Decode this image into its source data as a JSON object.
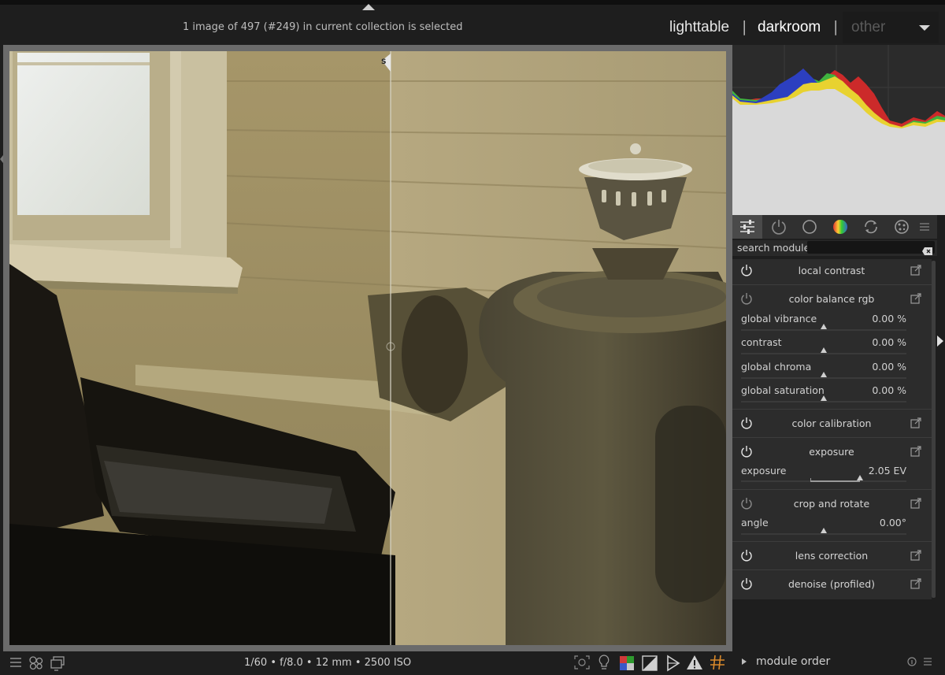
{
  "header": {
    "collection_info": "1 image of 497 (#249) in current collection is selected",
    "views": {
      "lighttable": "lighttable",
      "darkroom": "darkroom",
      "other": "other",
      "separator": "|"
    }
  },
  "module_groups": {
    "tabs": [
      "quick-access-icon",
      "active-modules-icon",
      "base-group-icon",
      "color-group-icon",
      "correct-group-icon",
      "effect-group-icon",
      "presets-menu-icon"
    ],
    "active_index": 0
  },
  "search": {
    "label": "search module",
    "placeholder": ""
  },
  "modules": [
    {
      "title": "local contrast",
      "enabled": true
    },
    {
      "title": "color balance rgb",
      "enabled": false,
      "sliders": [
        {
          "label": "global vibrance",
          "value": "0.00 %",
          "fraction": 0.5
        },
        {
          "label": "contrast",
          "value": "0.00 %",
          "fraction": 0.5
        },
        {
          "label": "global chroma",
          "value": "0.00 %",
          "fraction": 0.5
        },
        {
          "label": "global saturation",
          "value": "0.00 %",
          "fraction": 0.5
        }
      ]
    },
    {
      "title": "color calibration",
      "enabled": true
    },
    {
      "title": "exposure",
      "enabled": true,
      "sliders": [
        {
          "label": "exposure",
          "value": "2.05 EV",
          "fraction": 0.72
        }
      ]
    },
    {
      "title": "crop and rotate",
      "enabled": false,
      "sliders": [
        {
          "label": "angle",
          "value": "0.00°",
          "fraction": 0.5
        }
      ]
    },
    {
      "title": "lens correction",
      "enabled": true
    },
    {
      "title": "denoise (profiled)",
      "enabled": true
    }
  ],
  "image": {
    "split_marker": "S"
  },
  "footer": {
    "exif": "1/60 • f/8.0 • 12 mm • 2500 ISO",
    "module_order": "module order"
  },
  "colors": {
    "background": "#1e1e1e",
    "panel": "#2c2c2c",
    "text": "#c8c8c8"
  }
}
